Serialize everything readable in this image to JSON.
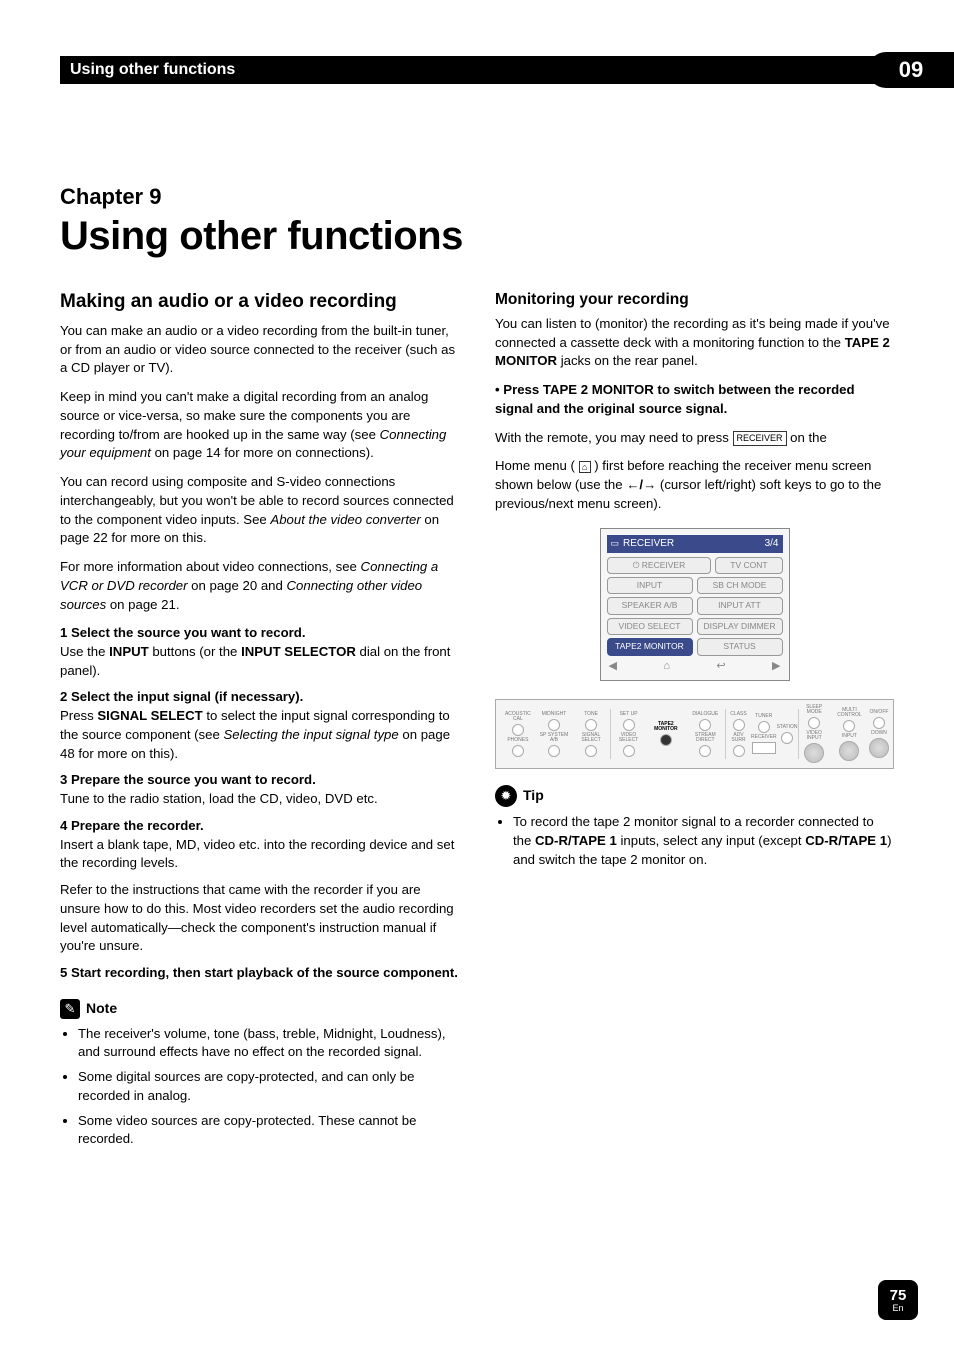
{
  "header": {
    "title": "Using other functions",
    "badge": "09"
  },
  "chapter": {
    "label": "Chapter 9",
    "title": "Using other functions"
  },
  "left": {
    "section_title": "Making an audio or a video recording",
    "p1": "You can make an audio or a video recording from the built-in tuner, or from an audio or video source connected to the receiver (such as a CD player or TV).",
    "p2a": "Keep in mind you can't make a digital recording from an analog source or vice-versa, so make sure the components you are recording to/from are hooked up in the same way (see ",
    "p2i": "Connecting your equipment",
    "p2b": " on page 14 for more on connections).",
    "p3a": "You can record using composite and S-video connections interchangeably, but you won't be able to record sources connected to the component video inputs. See ",
    "p3i": "About the video converter",
    "p3b": " on page 22 for more on this.",
    "p4a": "For more information about video connections, see ",
    "p4i1": "Connecting a VCR or DVD recorder",
    "p4m": " on page 20 and ",
    "p4i2": "Connecting other video sources",
    "p4b": " on page 21.",
    "s1t": "1   Select the source you want to record.",
    "s1ba": "Use the ",
    "s1bb": "INPUT",
    "s1bc": " buttons (or the ",
    "s1bd": "INPUT SELECTOR",
    "s1be": " dial on the front panel).",
    "s2t": "2   Select the input signal (if necessary).",
    "s2ba": "Press ",
    "s2bb": "SIGNAL SELECT",
    "s2bc": " to select the input signal corresponding to the source component (see ",
    "s2bi": "Selecting the input signal type",
    "s2bd": " on page 48 for more on this).",
    "s3t": "3   Prepare the source you want to record.",
    "s3b": "Tune to the radio station, load the CD, video, DVD etc.",
    "s4t": "4   Prepare the recorder.",
    "s4b1": "Insert a blank tape, MD, video etc. into the recording device and set the recording levels.",
    "s4b2": "Refer to the instructions that came with the recorder if you are unsure how to do this. Most video recorders set the audio recording level automatically—check the component's instruction manual if you're unsure.",
    "s5t": "5   Start recording, then start playback of the source component.",
    "note_label": "Note",
    "note_items": [
      "The receiver's volume, tone (bass, treble, Midnight, Loudness), and surround effects have no effect on the recorded signal.",
      "Some digital sources are copy-protected, and can only be recorded in analog.",
      "Some video sources are copy-protected. These cannot be recorded."
    ]
  },
  "right": {
    "sub_title": "Monitoring your recording",
    "r1a": "You can listen to (monitor) the recording as it's being made if you've connected a cassette deck with a monitoring function to the ",
    "r1b": "TAPE 2 MONITOR",
    "r1c": " jacks on the rear panel.",
    "bullet_press": "•   Press TAPE 2 MONITOR to switch between the recorded signal and the original source signal.",
    "r2a": "With the remote, you may need to press ",
    "r2icon": "RECEIVER",
    "r2b": " on the",
    "r3a": "Home menu ( ",
    "r3b": " ) first before reaching the receiver menu screen shown below (use the ",
    "r3c": " (cursor left/right) soft keys to go to the previous/next menu screen).",
    "menu": {
      "title_left": "RECEIVER",
      "title_right": "3/4",
      "rows": [
        [
          "⏻ RECEIVER",
          "TV CONT"
        ],
        [
          "INPUT",
          "SB CH MODE"
        ],
        [
          "SPEAKER A/B",
          "INPUT ATT"
        ],
        [
          "VIDEO SELECT",
          "DISPLAY DIMMER"
        ],
        [
          "TAPE2 MONITOR",
          "STATUS"
        ]
      ]
    },
    "remote_labels": {
      "row1": [
        "ACOUSTIC CAL",
        "MIDNIGHT",
        "TONE",
        "SET UP",
        "",
        "DIALOGUE",
        "CLASS",
        "TUNER",
        "STATION",
        "SLEEP MODE",
        "MULTI CONTROL",
        "ON/OFF"
      ],
      "row2": [
        "PHONES",
        "SP SYSTEM A/B",
        "SIGNAL SELECT",
        "VIDEO SELECT",
        "TAPE2 MONITOR",
        "STREAM DIRECT",
        "ADV SURR",
        "RECEIVER",
        "",
        "VIDEO INPUT",
        "",
        "INPUT",
        "DOWN"
      ]
    },
    "tip_label": "Tip",
    "tip_a": "To record the tape 2 monitor signal to a recorder connected to the ",
    "tip_b1": "CD-R/TAPE 1",
    "tip_c": " inputs, select any input (except ",
    "tip_b2": "CD-R/TAPE 1",
    "tip_d": ") and switch the tape 2 monitor on."
  },
  "footer": {
    "page": "75",
    "lang": "En"
  }
}
